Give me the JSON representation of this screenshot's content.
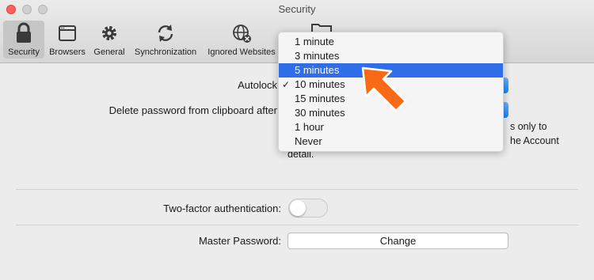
{
  "window": {
    "title": "Security"
  },
  "toolbar": {
    "tabs": [
      {
        "label": "Security",
        "icon": "lock-icon"
      },
      {
        "label": "Browsers",
        "icon": "browser-window-icon"
      },
      {
        "label": "General",
        "icon": "gear-icon"
      },
      {
        "label": "Synchronization",
        "icon": "sync-icon"
      },
      {
        "label": "Ignored Websites",
        "icon": "globe-blocked-icon"
      }
    ],
    "active_tab": "Security"
  },
  "settings": {
    "autolock_label": "Autolock",
    "clipboard_label": "Delete password from clipboard after",
    "desc_line1": "s only to",
    "desc_line2": "he Account",
    "desc_line3": "detail.",
    "two_factor_label": "Two-factor authentication:",
    "two_factor_on": false,
    "master_password_label": "Master Password:",
    "change_button": "Change"
  },
  "autolock_menu": {
    "options": [
      "1 minute",
      "3 minutes",
      "5 minutes",
      "10 minutes",
      "15 minutes",
      "30 minutes",
      "1 hour",
      "Never"
    ],
    "highlighted": "5 minutes",
    "checked": "10 minutes"
  },
  "colors": {
    "accent": "#2f6ee8",
    "annotation_arrow": "#f96a17"
  }
}
